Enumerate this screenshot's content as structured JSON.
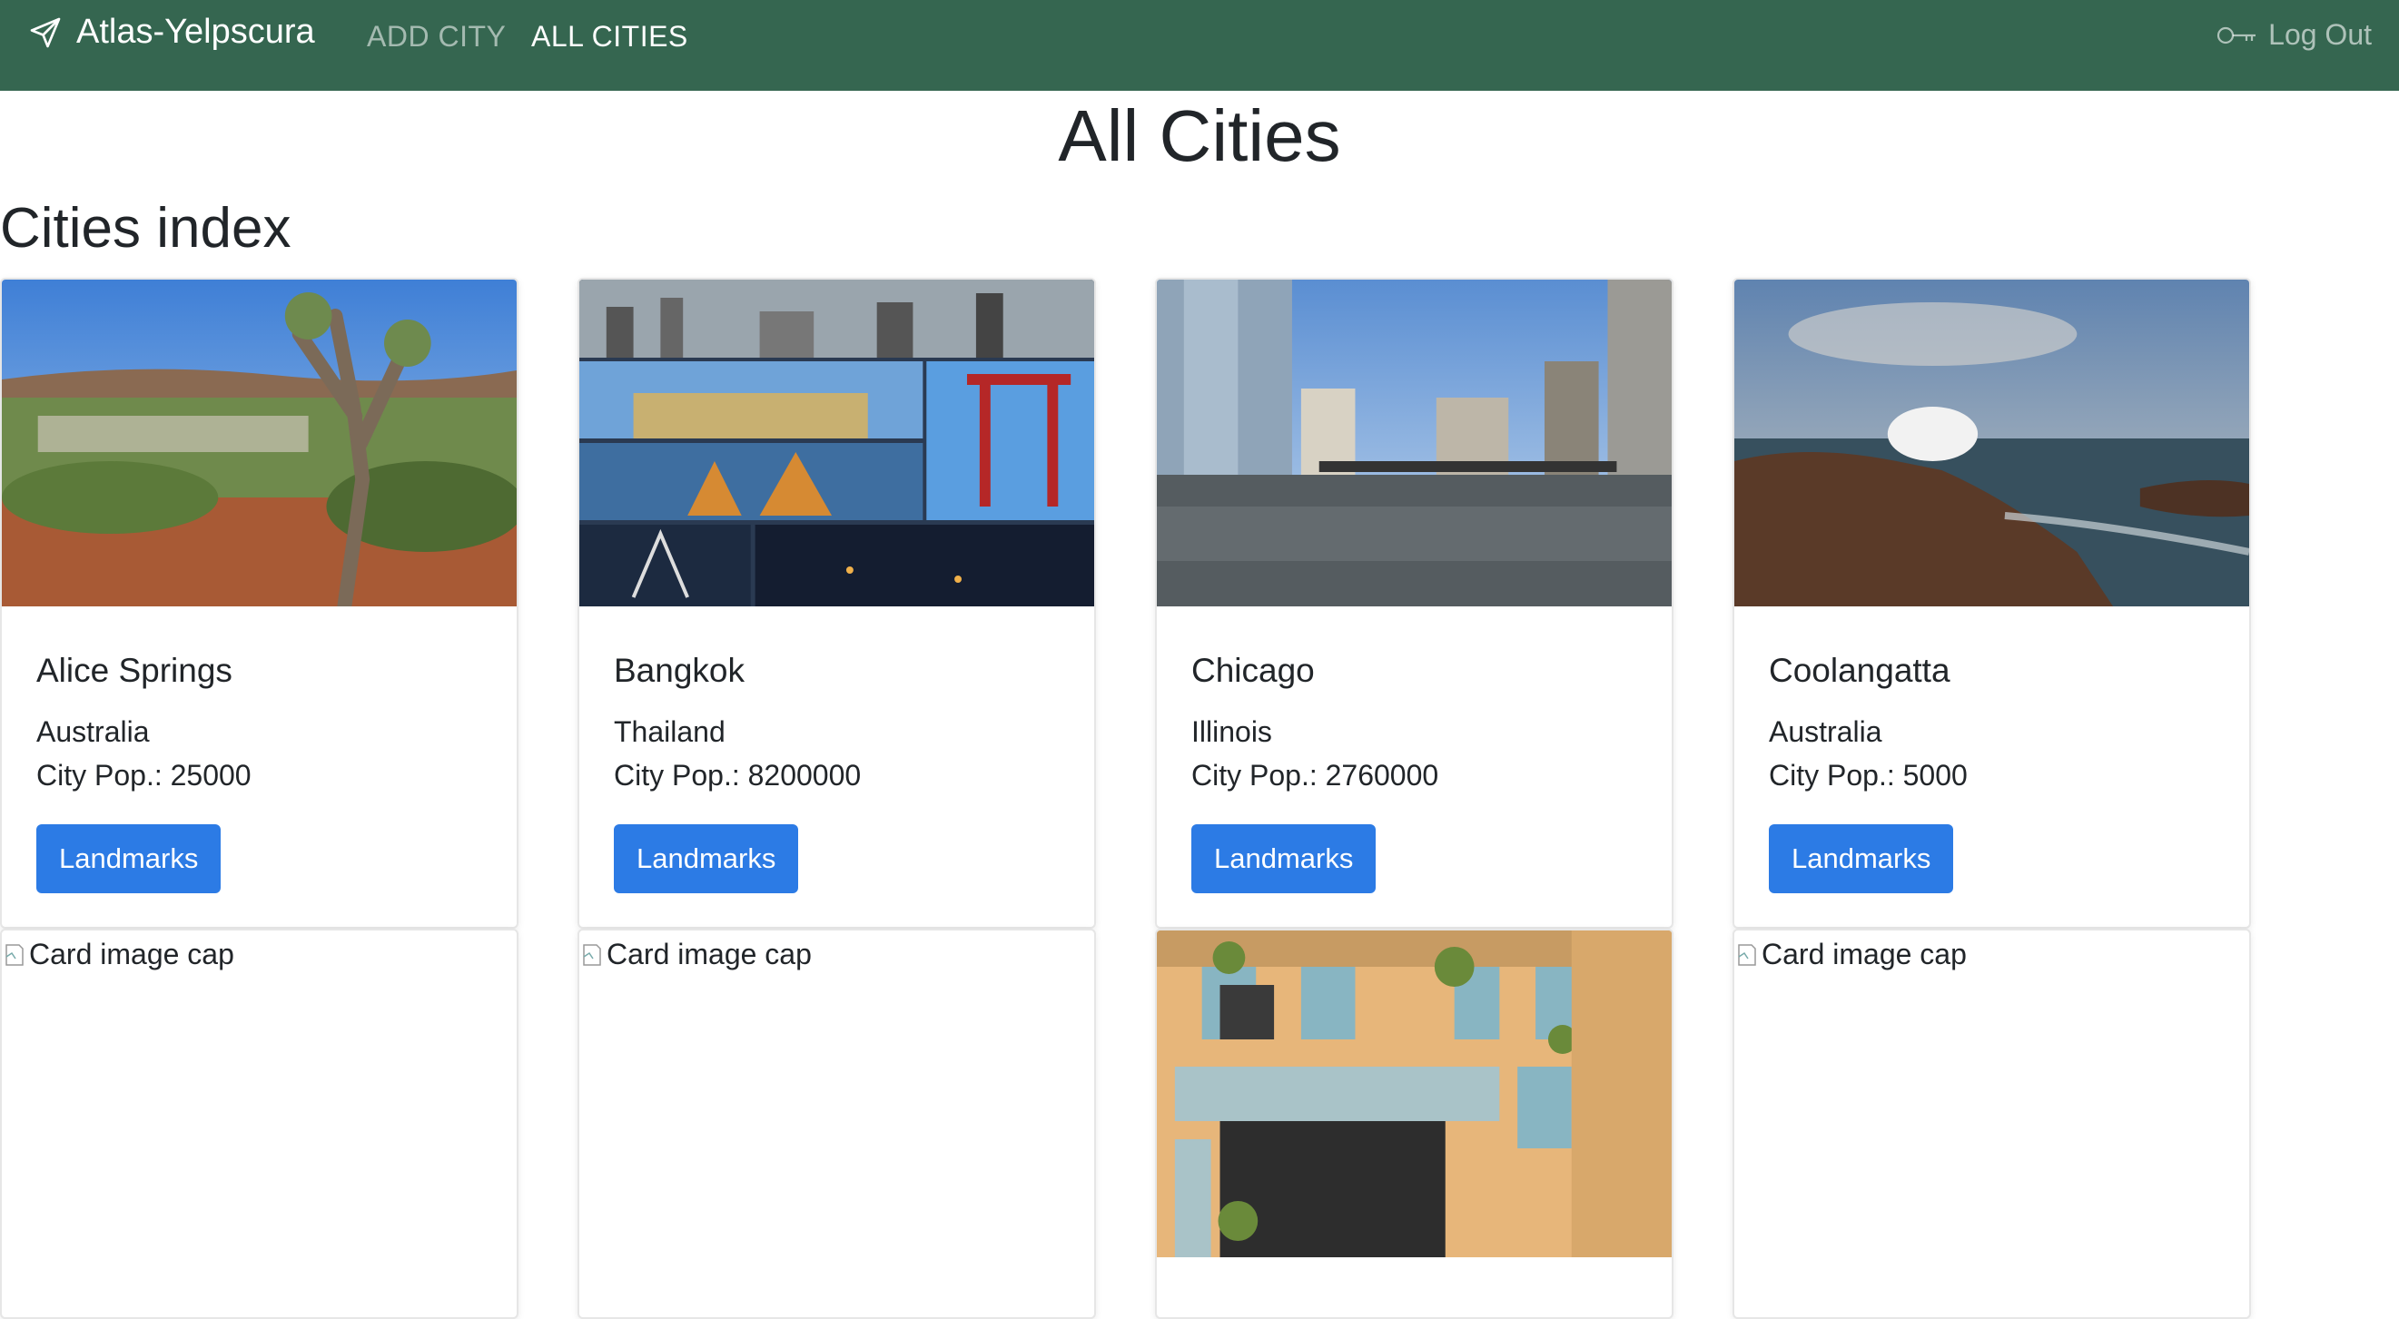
{
  "navbar": {
    "brand": "Atlas-Yelpscura",
    "links": [
      "ADD CITY",
      "ALL CITIES"
    ],
    "logout": "Log Out",
    "bg_color": "#356650"
  },
  "page_title": "All Cities",
  "section_title": "Cities index",
  "button_color": "#2c7be5",
  "cities": [
    {
      "name": "Alice Springs",
      "region": "Australia",
      "population": "City Pop.: 25000",
      "button": "Landmarks"
    },
    {
      "name": "Bangkok",
      "region": "Thailand",
      "population": "City Pop.: 8200000",
      "button": "Landmarks"
    },
    {
      "name": "Chicago",
      "region": "Illinois",
      "population": "City Pop.: 2760000",
      "button": "Landmarks"
    },
    {
      "name": "Coolangatta",
      "region": "Australia",
      "population": "City Pop.: 5000",
      "button": "Landmarks"
    }
  ],
  "second_row": [
    {
      "alt": "Card image cap"
    },
    {
      "alt": "Card image cap"
    },
    {
      "alt": ""
    },
    {
      "alt": "Card image cap"
    }
  ]
}
